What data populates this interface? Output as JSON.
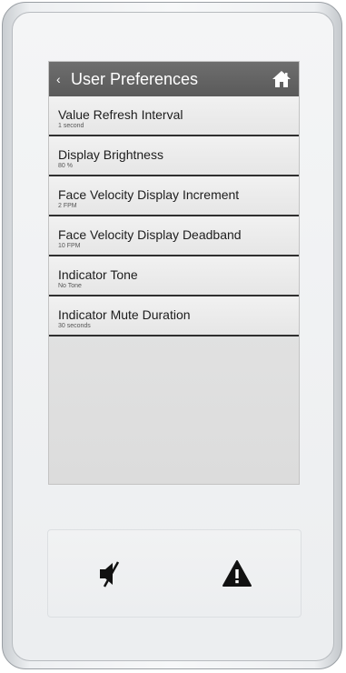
{
  "header": {
    "title": "User Preferences",
    "back_icon": "chevron-left-icon",
    "home_icon": "home-icon"
  },
  "menu": {
    "items": [
      {
        "label": "Value Refresh Interval",
        "value": "1 second"
      },
      {
        "label": "Display Brightness",
        "value": "80 %"
      },
      {
        "label": "Face Velocity Display Increment",
        "value": "2 FPM"
      },
      {
        "label": "Face Velocity Display Deadband",
        "value": "10 FPM"
      },
      {
        "label": "Indicator Tone",
        "value": "No Tone"
      },
      {
        "label": "Indicator Mute Duration",
        "value": "30 seconds"
      }
    ]
  },
  "hardware_buttons": {
    "mute_icon": "speaker-mute-icon",
    "alarm_icon": "warning-triangle-icon"
  },
  "colors": {
    "header_bg": "#636363",
    "screen_bg": "#e2e2e2",
    "divider": "#2f2f2f"
  }
}
